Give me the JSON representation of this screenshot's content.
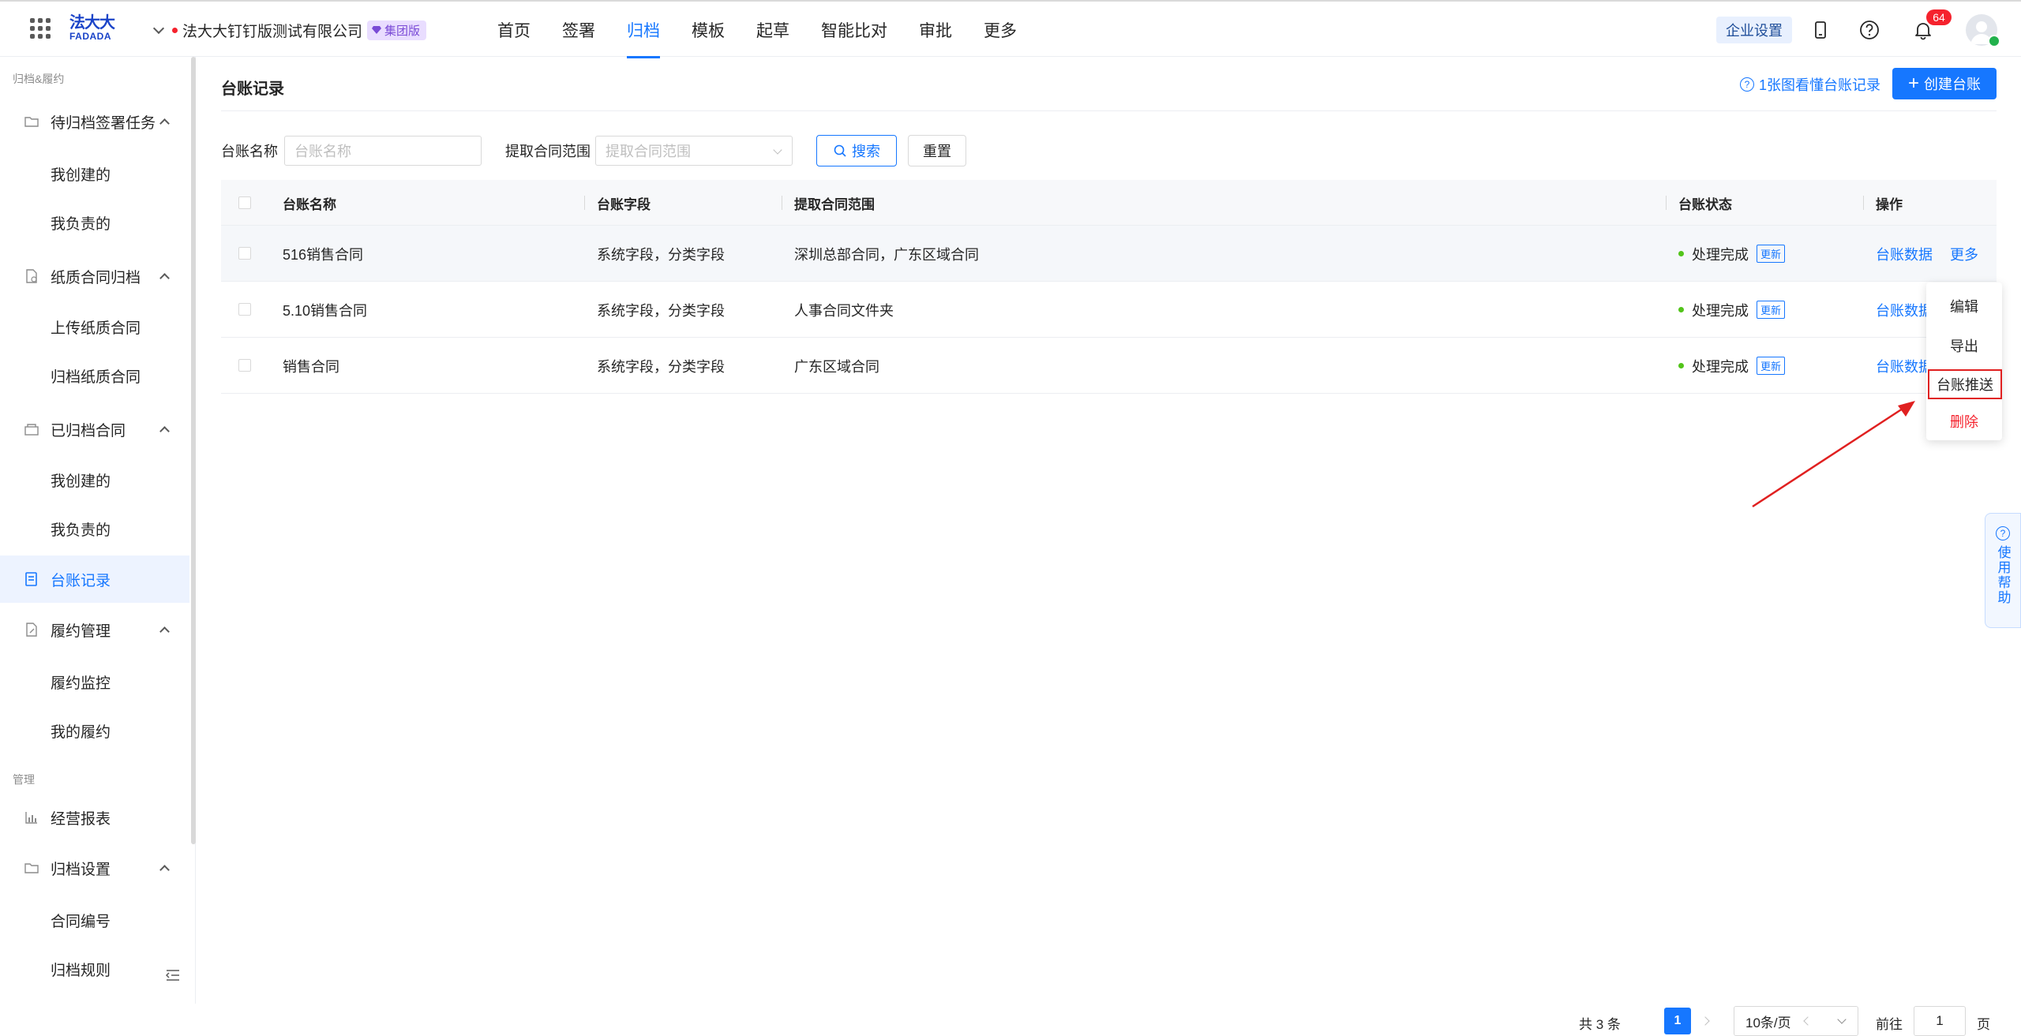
{
  "app": {
    "logo_cn": "法大大",
    "logo_en": "FADADA",
    "company_name": "法大大钉钉版测试有限公司",
    "edition_badge": "集团版"
  },
  "nav": {
    "items": [
      {
        "label": "首页",
        "active": false
      },
      {
        "label": "签署",
        "active": false
      },
      {
        "label": "归档",
        "active": true
      },
      {
        "label": "模板",
        "active": false
      },
      {
        "label": "起草",
        "active": false
      },
      {
        "label": "智能比对",
        "active": false
      },
      {
        "label": "审批",
        "active": false
      },
      {
        "label": "更多",
        "active": false
      }
    ],
    "enterprise_settings": "企业设置",
    "notification_count": "64"
  },
  "sidebar": {
    "section_archive": "归档&履约",
    "group_pending": "待归档签署任务",
    "pending_created": "我创建的",
    "pending_responsible": "我负责的",
    "group_paper": "纸质合同归档",
    "paper_upload": "上传纸质合同",
    "paper_archive": "归档纸质合同",
    "group_archived": "已归档合同",
    "archived_created": "我创建的",
    "archived_responsible": "我负责的",
    "ledger": "台账记录",
    "group_performance": "履约管理",
    "performance_monitor": "履约监控",
    "performance_mine": "我的履约",
    "section_manage": "管理",
    "reports": "经营报表",
    "group_settings": "归档设置",
    "contract_number": "合同编号",
    "archive_rules": "归档规则"
  },
  "main": {
    "title": "台账记录",
    "help_link": "1张图看懂台账记录",
    "create_button": "创建台账",
    "filters": {
      "name_label": "台账名称",
      "name_placeholder": "台账名称",
      "range_label": "提取合同范围",
      "range_placeholder": "提取合同范围",
      "search_button": "搜索",
      "reset_button": "重置"
    },
    "table": {
      "headers": {
        "name": "台账名称",
        "fields": "台账字段",
        "range": "提取合同范围",
        "status": "台账状态",
        "actions": "操作"
      },
      "rows": [
        {
          "name": "516销售合同",
          "fields": "系统字段，分类字段",
          "range": "深圳总部合同，广东区域合同",
          "status": "处理完成",
          "tag": "更新",
          "action_data": "台账数据",
          "action_more": "更多"
        },
        {
          "name": "5.10销售合同",
          "fields": "系统字段，分类字段",
          "range": "人事合同文件夹",
          "status": "处理完成",
          "tag": "更新",
          "action_data": "台账数据"
        },
        {
          "name": "销售合同",
          "fields": "系统字段，分类字段",
          "range": "广东区域合同",
          "status": "处理完成",
          "tag": "更新",
          "action_data": "台账数据"
        }
      ]
    },
    "more_menu": {
      "edit": "编辑",
      "export": "导出",
      "push": "台账推送",
      "delete": "删除"
    },
    "pagination": {
      "total": "共 3 条",
      "current_page": "1",
      "page_size": "10条/页",
      "goto_label": "前往",
      "goto_value": "1",
      "page_suffix": "页"
    },
    "help_float": "使用帮助"
  }
}
